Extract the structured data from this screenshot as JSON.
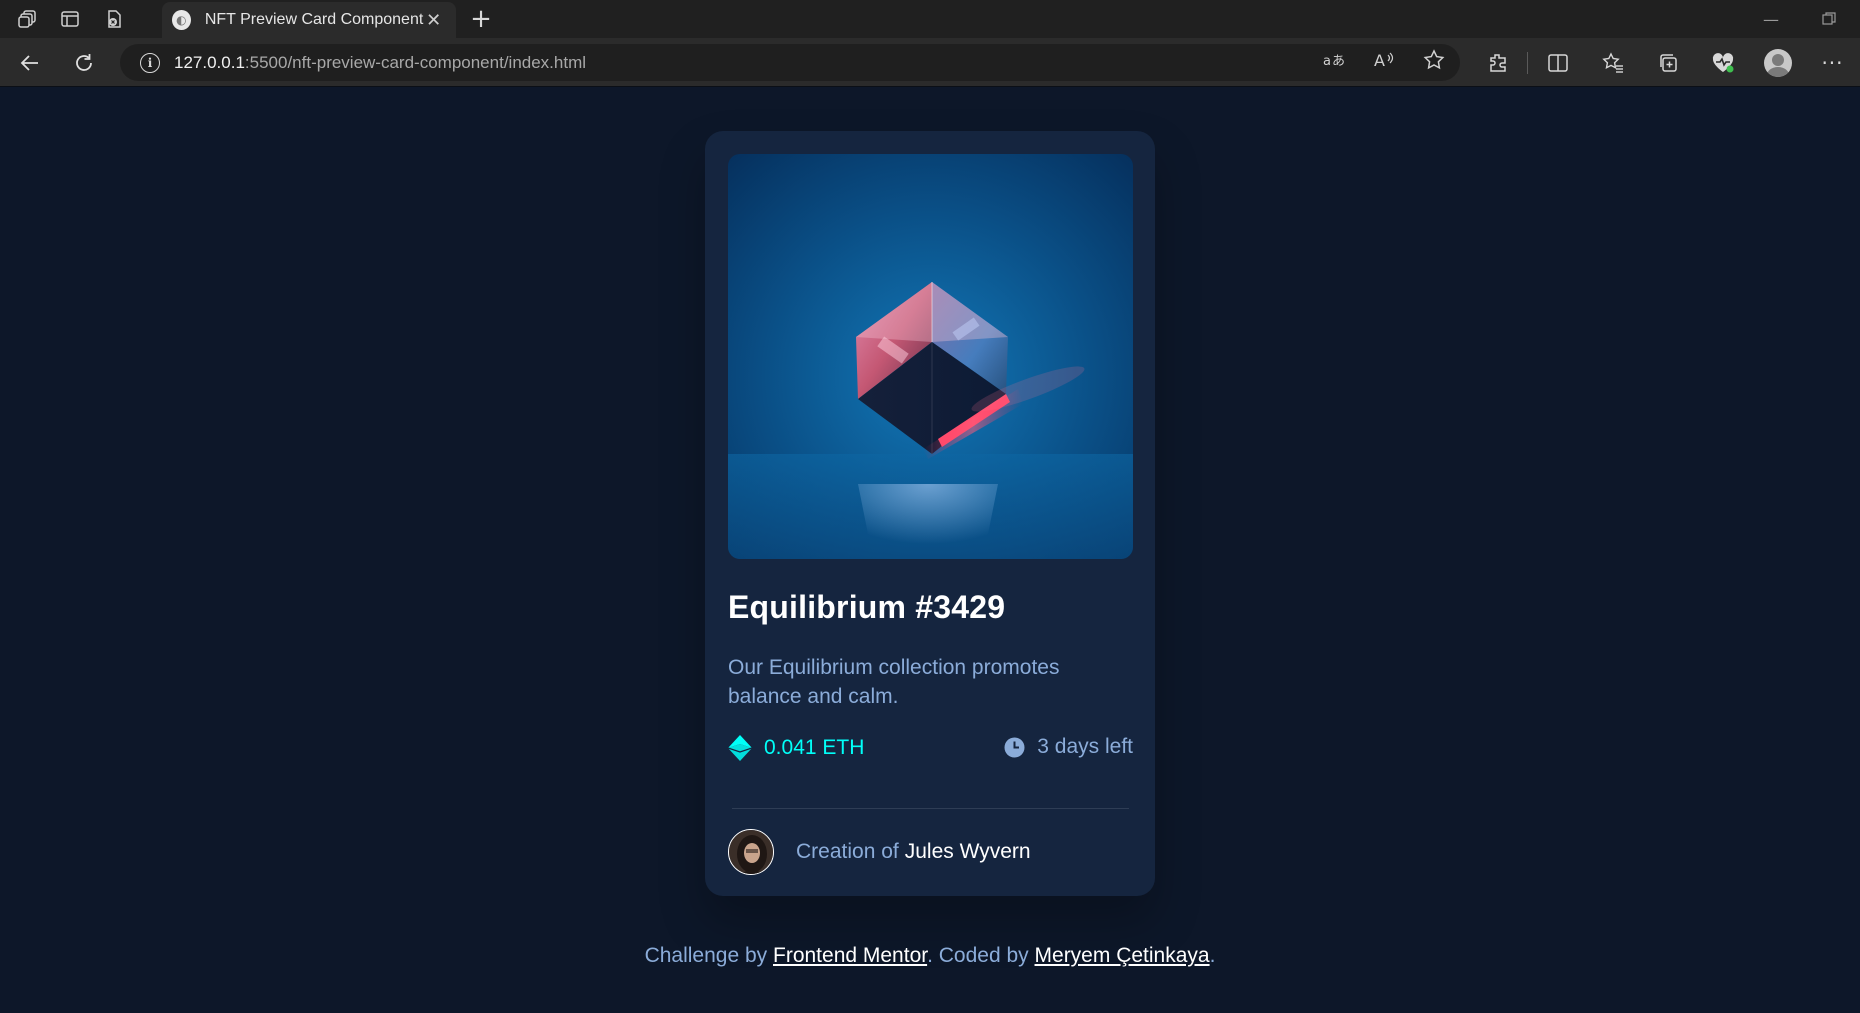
{
  "browser": {
    "tab_title": "NFT Preview Card Component",
    "url_host": "127.0.0.1",
    "url_rest": ":5500/nft-preview-card-component/index.html"
  },
  "card": {
    "title": "Equilibrium #3429",
    "description": "Our Equilibrium collection promotes balance and calm.",
    "price": "0.041 ETH",
    "time_left": "3 days left",
    "creator_prefix": "Creation of",
    "creator_name": "Jules Wyvern",
    "image_icon": "cube-image"
  },
  "footer": {
    "challenge_by": "Challenge by",
    "frontend_mentor": "Frontend Mentor",
    "coded_by": ". Coded by",
    "author": "Meryem Çetinkaya",
    "end": "."
  },
  "colors": {
    "page_bg": "#0d1729",
    "card_bg": "#15253f",
    "cyan": "#00fff8",
    "soft_blue": "#8bacd9",
    "white": "#ffffff"
  }
}
